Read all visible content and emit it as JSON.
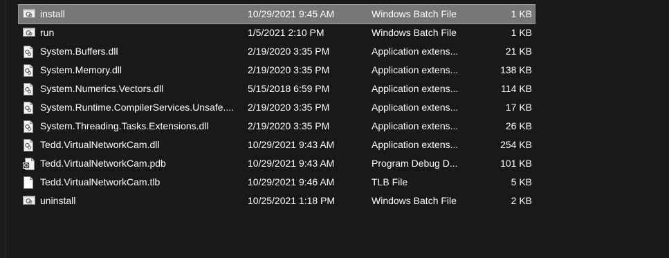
{
  "files": [
    {
      "name": "install",
      "date": "10/29/2021 9:45 AM",
      "type": "Windows Batch File",
      "size": "1 KB",
      "icon": "batch-file-icon",
      "selected": true
    },
    {
      "name": "run",
      "date": "1/5/2021 2:10 PM",
      "type": "Windows Batch File",
      "size": "1 KB",
      "icon": "batch-file-icon"
    },
    {
      "name": "System.Buffers.dll",
      "date": "2/19/2020 3:35 PM",
      "type": "Application extens...",
      "size": "21 KB",
      "icon": "dll-file-icon"
    },
    {
      "name": "System.Memory.dll",
      "date": "2/19/2020 3:35 PM",
      "type": "Application extens...",
      "size": "138 KB",
      "icon": "dll-file-icon"
    },
    {
      "name": "System.Numerics.Vectors.dll",
      "date": "5/15/2018 6:59 PM",
      "type": "Application extens...",
      "size": "114 KB",
      "icon": "dll-file-icon"
    },
    {
      "name": "System.Runtime.CompilerServices.Unsafe....",
      "date": "2/19/2020 3:35 PM",
      "type": "Application extens...",
      "size": "17 KB",
      "icon": "dll-file-icon"
    },
    {
      "name": "System.Threading.Tasks.Extensions.dll",
      "date": "2/19/2020 3:35 PM",
      "type": "Application extens...",
      "size": "26 KB",
      "icon": "dll-file-icon"
    },
    {
      "name": "Tedd.VirtualNetworkCam.dll",
      "date": "10/29/2021 9:43 AM",
      "type": "Application extens...",
      "size": "254 KB",
      "icon": "dll-file-icon"
    },
    {
      "name": "Tedd.VirtualNetworkCam.pdb",
      "date": "10/29/2021 9:43 AM",
      "type": "Program Debug D...",
      "size": "101 KB",
      "icon": "pdb-file-icon"
    },
    {
      "name": "Tedd.VirtualNetworkCam.tlb",
      "date": "10/29/2021 9:46 AM",
      "type": "TLB File",
      "size": "5 KB",
      "icon": "generic-file-icon"
    },
    {
      "name": "uninstall",
      "date": "10/25/2021 1:18 PM",
      "type": "Windows Batch File",
      "size": "2 KB",
      "icon": "batch-file-icon"
    }
  ]
}
